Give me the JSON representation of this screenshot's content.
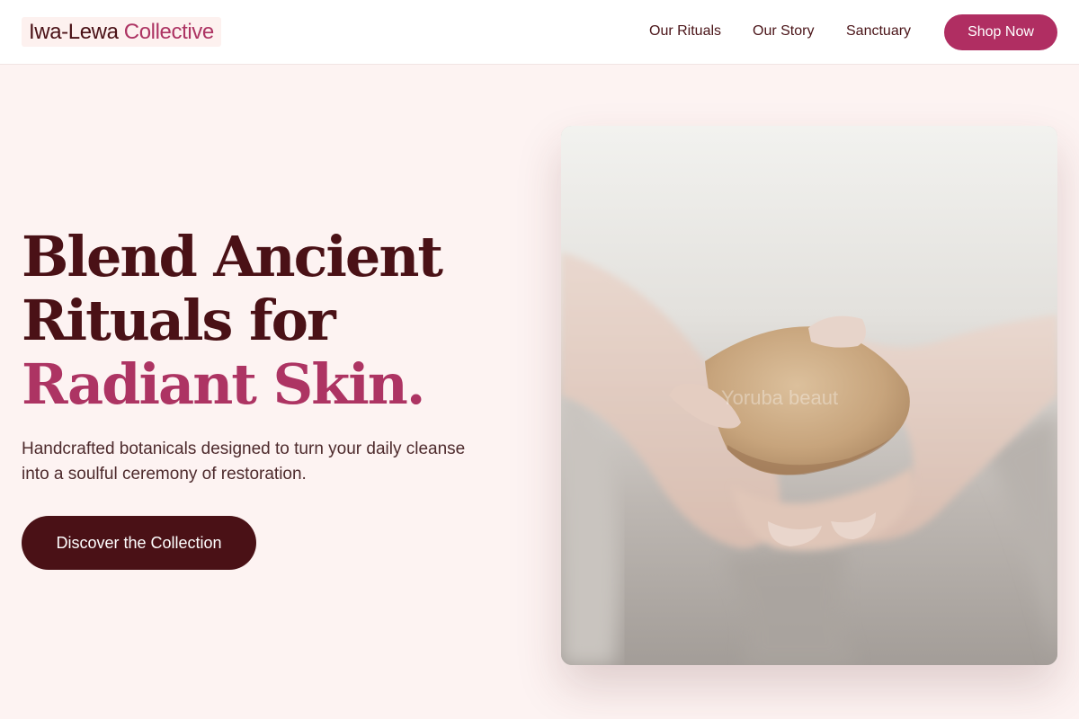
{
  "brand": {
    "name_part1": "Iwa-Lewa",
    "name_part2": "Collective"
  },
  "nav": {
    "links": [
      {
        "label": "Our Rituals"
      },
      {
        "label": "Our Story"
      },
      {
        "label": "Sanctuary"
      }
    ],
    "shop_label": "Shop Now"
  },
  "hero": {
    "headline_line1": "Blend Ancient",
    "headline_line2": "Rituals for",
    "headline_line3": "Radiant Skin.",
    "subtext": "Handcrafted botanicals designed to turn your daily cleanse into a soulful ceremony of restoration.",
    "cta_label": "Discover the Collection",
    "image_watermark": "Yoruba beaut"
  },
  "colors": {
    "primary_dark": "#4a1116",
    "accent": "#ad3463",
    "button_accent": "#b02e62",
    "background": "#fdf3f2"
  }
}
